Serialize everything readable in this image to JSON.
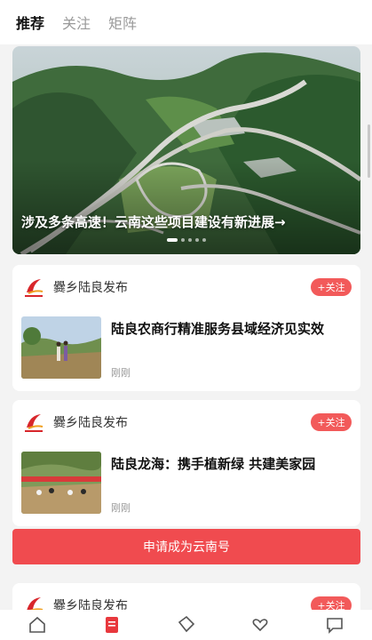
{
  "tabs": [
    {
      "label": "推荐",
      "active": true
    },
    {
      "label": "关注",
      "active": false
    },
    {
      "label": "矩阵",
      "active": false
    }
  ],
  "hero": {
    "title": "涉及多条高速！云南这些项目建设有新进展→",
    "slides_total": 5,
    "active_slide": 1
  },
  "articles": [
    {
      "source": "爨乡陆良发布",
      "follow_label": "+关注",
      "title": "陆良农商行精准服务县域经济见实效",
      "time": "刚刚"
    },
    {
      "source": "爨乡陆良发布",
      "follow_label": "+关注",
      "title": "陆良龙海：携手植新绿 共建美家园",
      "time": "刚刚"
    },
    {
      "source": "爨乡陆良发布",
      "follow_label": "+关注"
    }
  ],
  "apply_button": "申请成为云南号",
  "nav_icons": [
    "home-icon",
    "document-icon",
    "ticket-icon",
    "heart-hand-icon",
    "chat-icon"
  ],
  "colors": {
    "accent": "#f04b4f",
    "follow": "#f25a5a",
    "nav_active": "#e8383d"
  }
}
